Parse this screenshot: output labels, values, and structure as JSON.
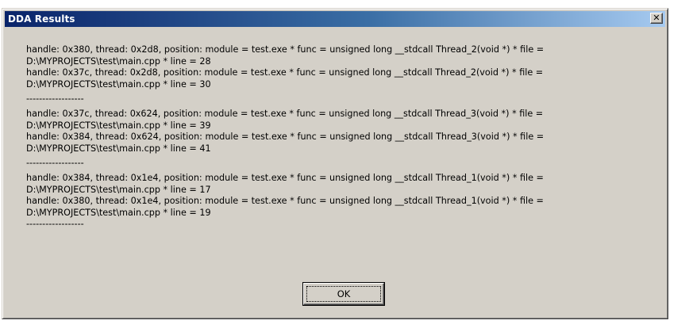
{
  "window": {
    "title": "DDA Results",
    "close_glyph": "✕"
  },
  "results": {
    "lines": [
      "handle: 0x380, thread: 0x2d8, position: module = test.exe * func = unsigned long __stdcall Thread_2(void *) * file =",
      "D:\\MYPROJECTS\\test\\main.cpp * line = 28",
      "handle: 0x37c, thread: 0x2d8, position: module = test.exe * func = unsigned long __stdcall Thread_2(void *) * file =",
      "D:\\MYPROJECTS\\test\\main.cpp * line = 30",
      "------------------",
      "handle: 0x37c, thread: 0x624, position: module = test.exe * func = unsigned long __stdcall Thread_3(void *) * file =",
      "D:\\MYPROJECTS\\test\\main.cpp * line = 39",
      "handle: 0x384, thread: 0x624, position: module = test.exe * func = unsigned long __stdcall Thread_3(void *) * file =",
      "D:\\MYPROJECTS\\test\\main.cpp * line = 41",
      "------------------",
      "handle: 0x384, thread: 0x1e4, position: module = test.exe * func = unsigned long __stdcall Thread_1(void *) * file =",
      "D:\\MYPROJECTS\\test\\main.cpp * line = 17",
      "handle: 0x380, thread: 0x1e4, position: module = test.exe * func = unsigned long __stdcall Thread_1(void *) * file =",
      "D:\\MYPROJECTS\\test\\main.cpp * line = 19",
      "------------------"
    ]
  },
  "buttons": {
    "ok_label": "OK"
  },
  "colors": {
    "dialog_bg": "#d4d0c8",
    "title_gradient_start": "#0a246a",
    "title_gradient_end": "#a6caf0",
    "title_text": "#ffffff"
  },
  "icons": {
    "close": "close-icon"
  }
}
